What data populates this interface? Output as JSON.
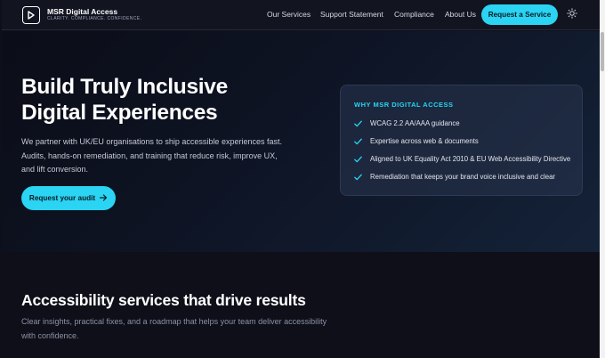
{
  "header": {
    "brand_name": "MSR Digital Access",
    "brand_tagline": "CLARITY. COMPLIANCE. CONFIDENCE.",
    "logo_icon": "logo-mark-icon",
    "nav": [
      {
        "label": "Our Services"
      },
      {
        "label": "Support Statement"
      },
      {
        "label": "Compliance"
      },
      {
        "label": "About Us"
      }
    ],
    "cta_label": "Request a Service",
    "theme_icon": "sun-icon"
  },
  "hero": {
    "title_line1": "Build Truly Inclusive",
    "title_line2": "Digital Experiences",
    "description": "We partner with UK/EU organisations to ship accessible experiences fast. Audits, hands-on remediation, and training that reduce risk, improve UX, and lift conversion.",
    "button_label": "Request your audit",
    "button_icon": "arrow-right-icon"
  },
  "why_card": {
    "title": "WHY MSR DIGITAL ACCESS",
    "items": [
      {
        "text": "WCAG 2.2 AA/AAA guidance"
      },
      {
        "text": "Expertise across web & documents"
      },
      {
        "text": "Aligned to UK Equality Act 2010 & EU Web Accessibility Directive"
      },
      {
        "text": "Remediation that keeps your brand voice inclusive and clear"
      }
    ],
    "item_icon": "checkmark-icon"
  },
  "services": {
    "title": "Accessibility services that drive results",
    "description": "Clear insights, practical fixes, and a roadmap that helps your team deliver accessibility with confidence."
  },
  "colors": {
    "accent": "#2ad4f2",
    "background": "#0d0f1a",
    "header": "#121420"
  }
}
